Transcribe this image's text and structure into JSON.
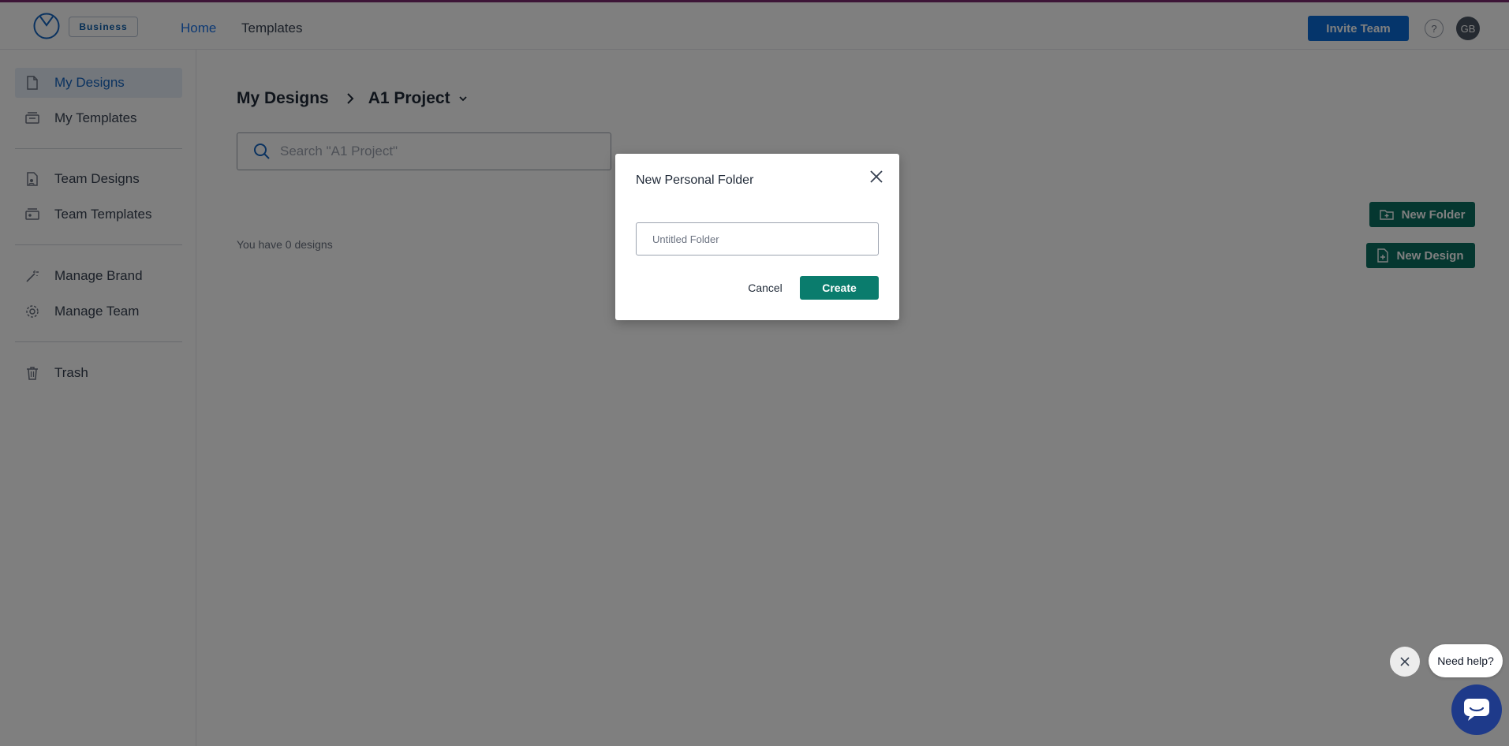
{
  "header": {
    "plan_badge": "Business",
    "nav": {
      "home": "Home",
      "templates": "Templates"
    },
    "invite_label": "Invite Team",
    "help_label": "?",
    "avatar_initials": "GB"
  },
  "sidebar": {
    "items": [
      {
        "label": "My Designs",
        "icon": "file-icon",
        "active": true
      },
      {
        "label": "My Templates",
        "icon": "template-icon",
        "active": false
      },
      {
        "label": "Team Designs",
        "icon": "team-file-icon",
        "active": false
      },
      {
        "label": "Team Templates",
        "icon": "team-template-icon",
        "active": false
      },
      {
        "label": "Manage Brand",
        "icon": "wand-icon",
        "active": false
      },
      {
        "label": "Manage Team",
        "icon": "gear-icon",
        "active": false
      },
      {
        "label": "Trash",
        "icon": "trash-icon",
        "active": false
      }
    ]
  },
  "main": {
    "breadcrumb": {
      "root": "My Designs",
      "current": "A1 Project"
    },
    "search_placeholder": "Search \"A1 Project\"",
    "designs_count": "You have 0 designs",
    "new_folder_label": "New Folder",
    "new_design_label": "New Design"
  },
  "modal": {
    "title": "New Personal Folder",
    "input_placeholder": "Untitled Folder",
    "cancel_label": "Cancel",
    "create_label": "Create"
  },
  "help_widget": {
    "bubble_text": "Need help?"
  },
  "colors": {
    "brand_blue": "#0b6bd6",
    "action_green": "#0a6e61",
    "active_nav_bg": "#e6eef8",
    "accent_purple": "#7a2b6e"
  }
}
